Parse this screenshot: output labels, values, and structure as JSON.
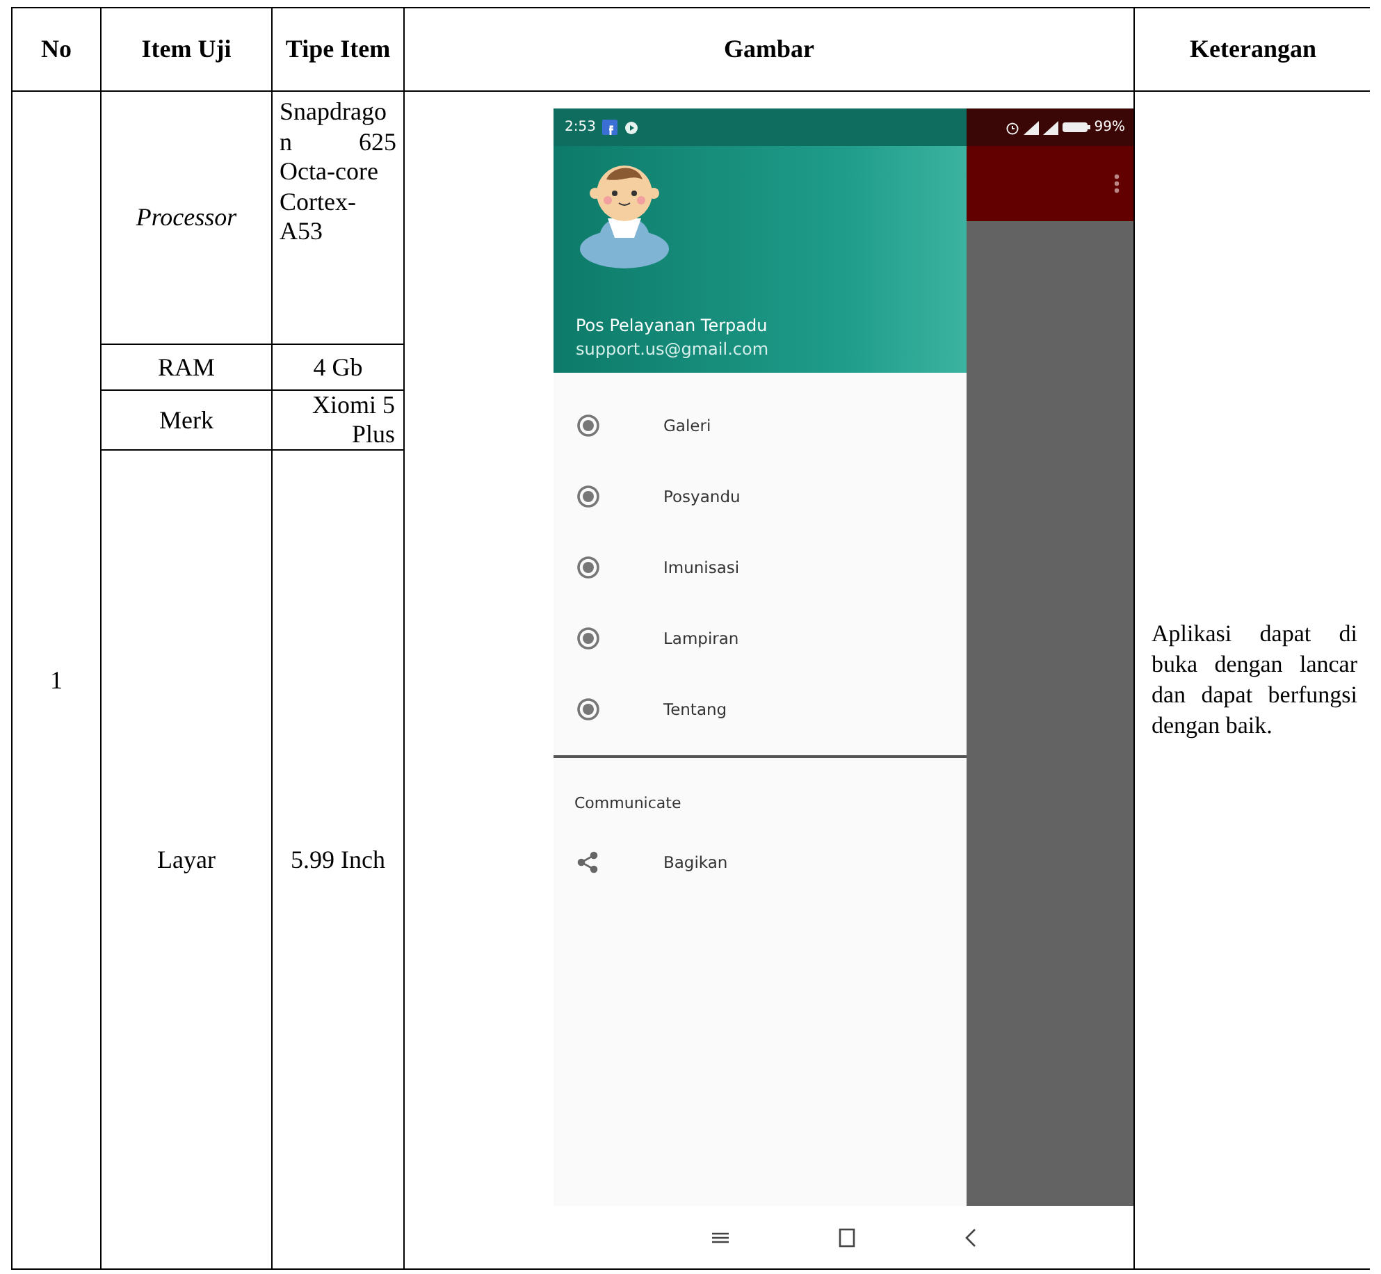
{
  "table": {
    "columns": [
      "No",
      "Item Uji",
      "Tipe Item",
      "Gambar",
      "Keterangan"
    ],
    "row": {
      "no": "1",
      "specs": [
        {
          "item": "Processor",
          "italic": true,
          "type": "Snapdragon 625 Octa-core Cortex-A53"
        },
        {
          "item": "RAM",
          "italic": false,
          "type": "4 Gb"
        },
        {
          "item": "Merk",
          "italic": false,
          "type": "Xiomi 5 Plus"
        },
        {
          "item": "Layar",
          "italic": false,
          "type": "5.99 Inch"
        }
      ],
      "screenshot": {
        "status_bar": {
          "time": "2:53",
          "battery": "99%"
        },
        "drawer": {
          "title": "Pos Pelayanan Terpadu",
          "email": "support.us@gmail.com",
          "items": [
            {
              "label": "Galeri"
            },
            {
              "label": "Posyandu"
            },
            {
              "label": "Imunisasi"
            },
            {
              "label": "Lampiran"
            },
            {
              "label": "Tentang"
            }
          ],
          "section": {
            "title": "Communicate",
            "items": [
              {
                "label": "Bagikan"
              }
            ]
          }
        }
      },
      "keterangan": "Aplikasi dapat di buka dengan lancar dan dapat berfungsi dengan baik."
    }
  }
}
